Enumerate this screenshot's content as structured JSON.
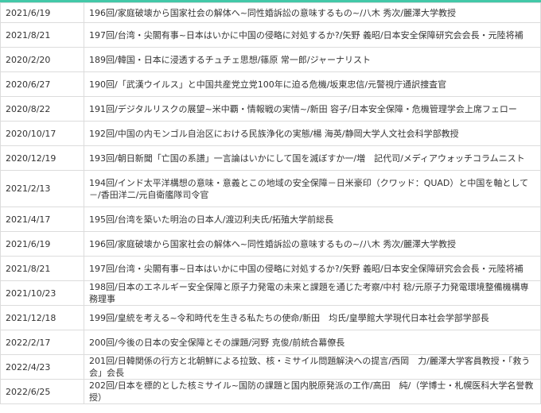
{
  "lectures": [
    {
      "date": "2021/6/19",
      "title": "196回/家庭破壊から国家社会の解体へ~同性婚訴訟の意味するもの~/八木 秀次/麗澤大学教授"
    },
    {
      "date": "2021/8/21",
      "title": "197回/台湾・尖閣有事~日本はいかに中国の侵略に対処するか?/矢野 義昭/日本安全保障研究会会長・元陸将補"
    },
    {
      "date": "2020/2/20",
      "title": "189回/韓国・日本に浸透するチュチェ思想/篠原 常一郎/ジャーナリスト"
    },
    {
      "date": "2020/6/27",
      "title": "190回/「武漢ウイルス」と中国共産党立党100年に迫る危機/坂東忠信/元警視庁通訳捜査官"
    },
    {
      "date": "2020/8/22",
      "title": "191回/デジタルリスクの展望~米中覇・情報戦の実情~/新田 容子/日本安全保障・危機管理学会上席フェロー"
    },
    {
      "date": "2020/10/17",
      "title": "192回/中国の内モンゴル自治区における民族浄化の実態/楊 海英/静岡大学人文社会科学部教授"
    },
    {
      "date": "2020/12/19",
      "title": "193回/朝日新聞「亡国の系譜」一言論はいかにして国を滅ぼすか一/増　記代司/メディアウォッチコラムニスト"
    },
    {
      "date": "2021/2/13",
      "title": "194回/インド太平洋構想の意味・意義とこの地域の安全保障－日米豪印（クワッド：QUAD）と中国を軸として－/香田洋二/元自衛艦隊司令官"
    },
    {
      "date": "2021/4/17",
      "title": "195回/台湾を築いた明治の日本人/渡辺利夫氏/拓殖大学前総長"
    },
    {
      "date": "2021/6/19",
      "title": "196回/家庭破壊から国家社会の解体へ~同性婚訴訟の意味するもの~/八木 秀次/麗澤大学教授"
    },
    {
      "date": "2021/8/21",
      "title": "197回/台湾・尖閣有事~日本はいかに中国の侵略に対処するか?/矢野 義昭/日本安全保障研究会会長・元陸将補"
    },
    {
      "date": "2021/10/23",
      "title": "198回/日本のエネルギー安全保障と原子力発電の未来と課題を通じた考察/中村 稔/元原子力発電環境整備機構専務理事"
    },
    {
      "date": "2021/12/18",
      "title": "199回/皇統を考える~令和時代を生きる私たちの使命/新田　均氏/皇學館大学現代日本社会学部学部長"
    },
    {
      "date": "2022/2/17",
      "title": "200回/今後の日本の安全保障とその課題/河野 克俊/前統合幕僚長"
    },
    {
      "date": "2022/4/23",
      "title": "201回/日韓関係の行方と北朝鮮による拉致、核・ミサイル問題解決への提言/西岡　力/麗澤大学客員教授・「救う会」会長"
    },
    {
      "date": "2022/6/25",
      "title": "202回/日本を標的とした核ミサイル~国防の課題と国内脱原発派の工作/高田　純/（学博士・札幌医科大学名誉教授）"
    }
  ]
}
